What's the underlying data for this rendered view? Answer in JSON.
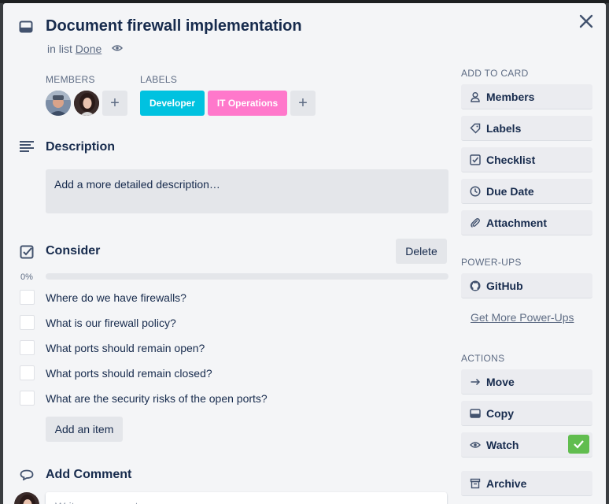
{
  "card": {
    "title": "Document firewall implementation",
    "in_list_prefix": "in list",
    "list_name": "Done"
  },
  "members": {
    "label": "MEMBERS",
    "add_label": "+"
  },
  "labels": {
    "label": "LABELS",
    "items": [
      {
        "text": "Developer",
        "color": "#00c2e0"
      },
      {
        "text": "IT Operations",
        "color": "#ff78cb"
      }
    ],
    "add_label": "+"
  },
  "description": {
    "title": "Description",
    "placeholder": "Add a more detailed description…"
  },
  "checklist": {
    "title": "Consider",
    "delete_label": "Delete",
    "progress_text": "0%",
    "progress": 0,
    "items": [
      {
        "text": "Where do we have firewalls?",
        "checked": false
      },
      {
        "text": "What is our firewall policy?",
        "checked": false
      },
      {
        "text": "What ports should remain open?",
        "checked": false
      },
      {
        "text": "What ports should remain closed?",
        "checked": false
      },
      {
        "text": "What are the security risks of the open ports?",
        "checked": false
      }
    ],
    "add_item_label": "Add an item"
  },
  "comment": {
    "title": "Add Comment",
    "placeholder": "Write a comment…"
  },
  "sidebar": {
    "add_to_card_label": "ADD TO CARD",
    "add_to_card": [
      {
        "label": "Members",
        "icon": "person-icon"
      },
      {
        "label": "Labels",
        "icon": "tag-icon"
      },
      {
        "label": "Checklist",
        "icon": "checklist-icon"
      },
      {
        "label": "Due Date",
        "icon": "clock-icon"
      },
      {
        "label": "Attachment",
        "icon": "paperclip-icon"
      }
    ],
    "powerups_label": "POWER-UPS",
    "powerups": [
      {
        "label": "GitHub",
        "icon": "github-icon"
      }
    ],
    "get_more_powerups": "Get More Power-Ups",
    "actions_label": "ACTIONS",
    "actions": [
      {
        "label": "Move",
        "icon": "arrow-right-icon"
      },
      {
        "label": "Copy",
        "icon": "card-icon"
      },
      {
        "label": "Watch",
        "icon": "eye-icon",
        "active": true
      },
      {
        "label": "Archive",
        "icon": "archive-icon"
      }
    ]
  },
  "colors": {
    "accent_green": "#61bd4f",
    "label_cyan": "#00c2e0",
    "label_pink": "#ff78cb"
  }
}
